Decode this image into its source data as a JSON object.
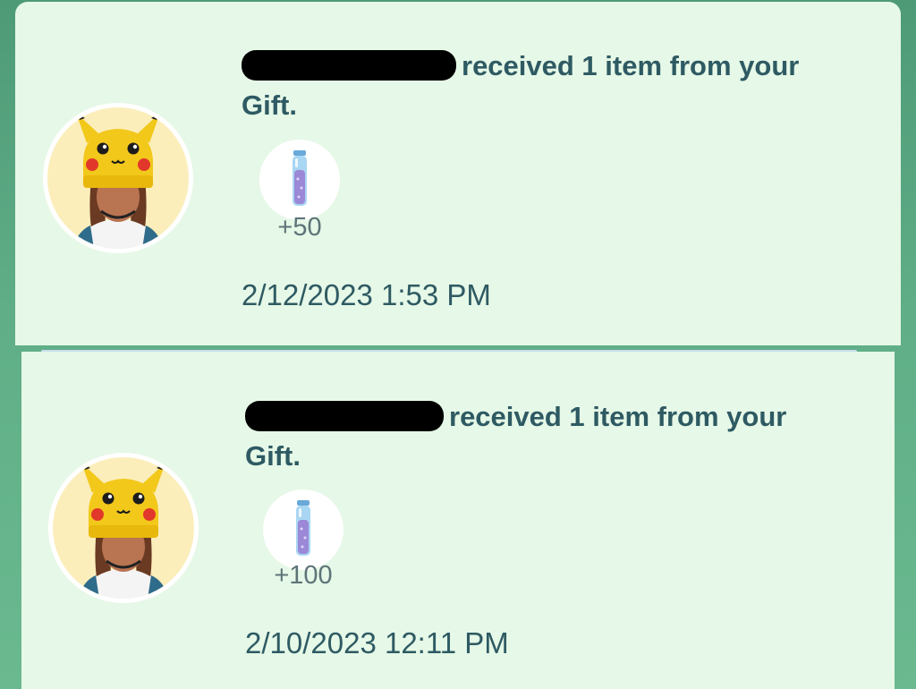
{
  "gifts": [
    {
      "message_suffix": "received 1 item from your Gift.",
      "item_icon": "stardust-vial-icon",
      "item_quantity": "+50",
      "timestamp": "2/12/2023 1:53 PM"
    },
    {
      "message_suffix": "received 1 item from your Gift.",
      "item_icon": "stardust-vial-icon",
      "item_quantity": "+100",
      "timestamp": "2/10/2023 12:11 PM"
    }
  ],
  "colors": {
    "card_background": "#e6f8e7",
    "page_background": "#5fae87",
    "text_primary": "#2e5a63",
    "text_secondary": "#5d7478",
    "avatar_background": "#fbeebb"
  }
}
